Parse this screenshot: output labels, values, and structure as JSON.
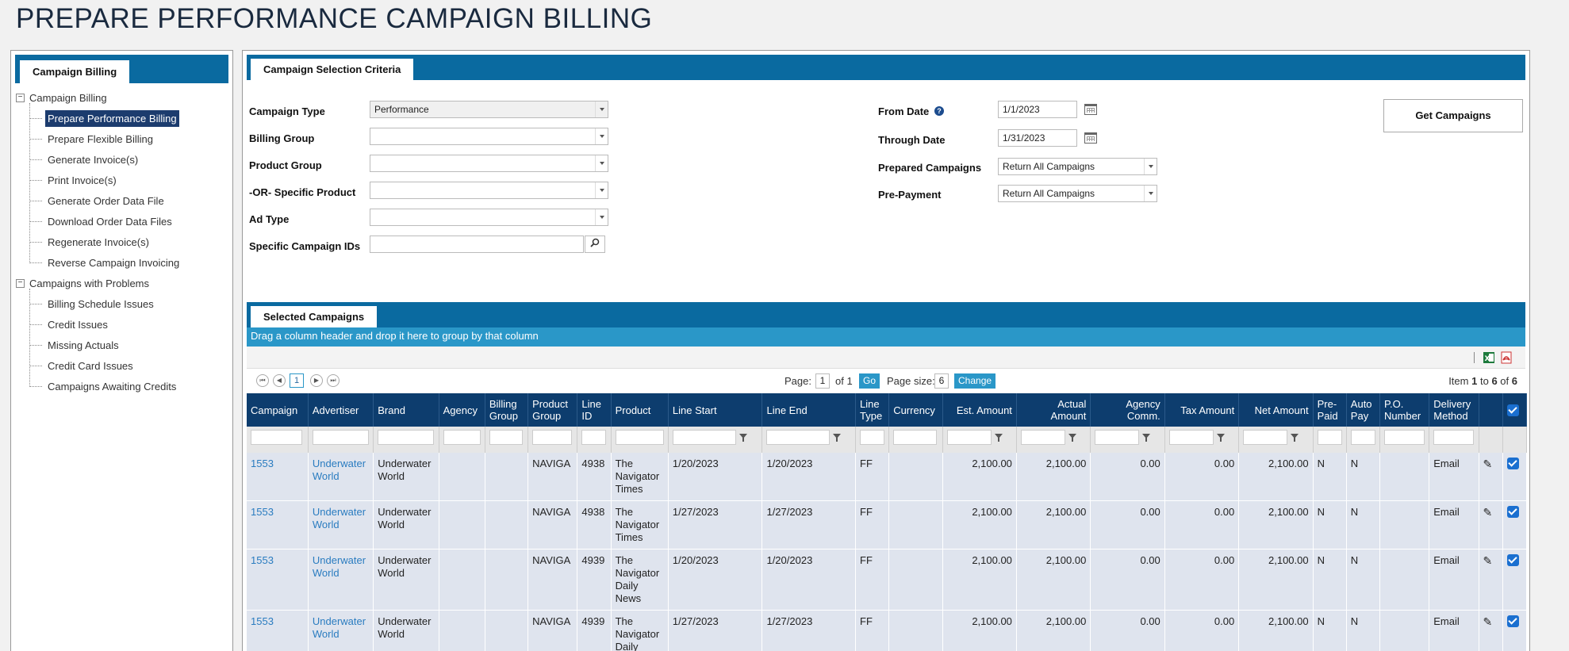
{
  "page": {
    "title": "PREPARE PERFORMANCE CAMPAIGN BILLING"
  },
  "sidebar": {
    "tab_label": "Campaign Billing",
    "groups": [
      {
        "label": "Campaign Billing",
        "items": [
          {
            "label": "Prepare Performance Billing",
            "selected": true
          },
          {
            "label": "Prepare Flexible Billing"
          },
          {
            "label": "Generate Invoice(s)"
          },
          {
            "label": "Print Invoice(s)"
          },
          {
            "label": "Generate Order Data File"
          },
          {
            "label": "Download Order Data Files"
          },
          {
            "label": "Regenerate Invoice(s)"
          },
          {
            "label": "Reverse Campaign Invoicing"
          }
        ]
      },
      {
        "label": "Campaigns with Problems",
        "items": [
          {
            "label": "Billing Schedule Issues"
          },
          {
            "label": "Credit Issues"
          },
          {
            "label": "Missing Actuals"
          },
          {
            "label": "Credit Card Issues"
          },
          {
            "label": "Campaigns Awaiting Credits"
          }
        ]
      }
    ]
  },
  "criteria": {
    "tab_label": "Campaign Selection Criteria",
    "campaign_type": {
      "label": "Campaign Type",
      "value": "Performance"
    },
    "billing_group": {
      "label": "Billing Group",
      "value": ""
    },
    "product_group": {
      "label": "Product Group",
      "value": ""
    },
    "specific_product": {
      "label": "-OR- Specific Product",
      "value": ""
    },
    "ad_type": {
      "label": "Ad Type",
      "value": ""
    },
    "campaign_ids": {
      "label": "Specific Campaign IDs",
      "value": ""
    },
    "from_date": {
      "label": "From Date",
      "value": "1/1/2023"
    },
    "through_date": {
      "label": "Through Date",
      "value": "1/31/2023"
    },
    "prepared_campaigns": {
      "label": "Prepared Campaigns",
      "value": "Return All Campaigns"
    },
    "pre_payment": {
      "label": "Pre-Payment",
      "value": "Return All Campaigns"
    },
    "get_button": "Get Campaigns"
  },
  "selected": {
    "tab_label": "Selected Campaigns",
    "group_hint": "Drag a column header and drop it here to group by that column",
    "pager": {
      "current_page": "1",
      "page_label": "Page:",
      "page_input": "1",
      "of_label": "of 1",
      "go_label": "Go",
      "page_size_label": "Page size:",
      "page_size": "6",
      "change_label": "Change",
      "item_word": "Item",
      "item_from": "1",
      "item_to_word": "to",
      "item_to": "6",
      "item_of_word": "of",
      "item_total": "6"
    },
    "columns": [
      "Campaign",
      "Advertiser",
      "Brand",
      "Agency",
      "Billing Group",
      "Product Group",
      "Line ID",
      "Product",
      "Line Start",
      "Line End",
      "Line Type",
      "Currency",
      "Est. Amount",
      "Actual Amount",
      "Agency Comm.",
      "Tax Amount",
      "Net Amount",
      "Pre-Paid",
      "Auto Pay",
      "P.O. Number",
      "Delivery Method"
    ],
    "rows": [
      {
        "campaign": "1553",
        "advertiser": "Underwater World",
        "brand": "Underwater World",
        "agency": "",
        "billing_group": "",
        "product_group": "NAVIGA",
        "line_id": "4938",
        "product": "The Navigator Times",
        "line_start": "1/20/2023",
        "line_end": "1/20/2023",
        "line_type": "FF",
        "currency": "",
        "est_amount": "2,100.00",
        "actual_amount": "2,100.00",
        "agency_comm": "0.00",
        "tax_amount": "0.00",
        "net_amount": "2,100.00",
        "pre_paid": "N",
        "auto_pay": "N",
        "po_number": "",
        "delivery_method": "Email"
      },
      {
        "campaign": "1553",
        "advertiser": "Underwater World",
        "brand": "Underwater World",
        "agency": "",
        "billing_group": "",
        "product_group": "NAVIGA",
        "line_id": "4938",
        "product": "The Navigator Times",
        "line_start": "1/27/2023",
        "line_end": "1/27/2023",
        "line_type": "FF",
        "currency": "",
        "est_amount": "2,100.00",
        "actual_amount": "2,100.00",
        "agency_comm": "0.00",
        "tax_amount": "0.00",
        "net_amount": "2,100.00",
        "pre_paid": "N",
        "auto_pay": "N",
        "po_number": "",
        "delivery_method": "Email"
      },
      {
        "campaign": "1553",
        "advertiser": "Underwater World",
        "brand": "Underwater World",
        "agency": "",
        "billing_group": "",
        "product_group": "NAVIGA",
        "line_id": "4939",
        "product": "The Navigator Daily News",
        "line_start": "1/20/2023",
        "line_end": "1/20/2023",
        "line_type": "FF",
        "currency": "",
        "est_amount": "2,100.00",
        "actual_amount": "2,100.00",
        "agency_comm": "0.00",
        "tax_amount": "0.00",
        "net_amount": "2,100.00",
        "pre_paid": "N",
        "auto_pay": "N",
        "po_number": "",
        "delivery_method": "Email"
      },
      {
        "campaign": "1553",
        "advertiser": "Underwater World",
        "brand": "Underwater World",
        "agency": "",
        "billing_group": "",
        "product_group": "NAVIGA",
        "line_id": "4939",
        "product": "The Navigator Daily News",
        "line_start": "1/27/2023",
        "line_end": "1/27/2023",
        "line_type": "FF",
        "currency": "",
        "est_amount": "2,100.00",
        "actual_amount": "2,100.00",
        "agency_comm": "0.00",
        "tax_amount": "0.00",
        "net_amount": "2,100.00",
        "pre_paid": "N",
        "auto_pay": "N",
        "po_number": "",
        "delivery_method": "Email"
      }
    ]
  }
}
